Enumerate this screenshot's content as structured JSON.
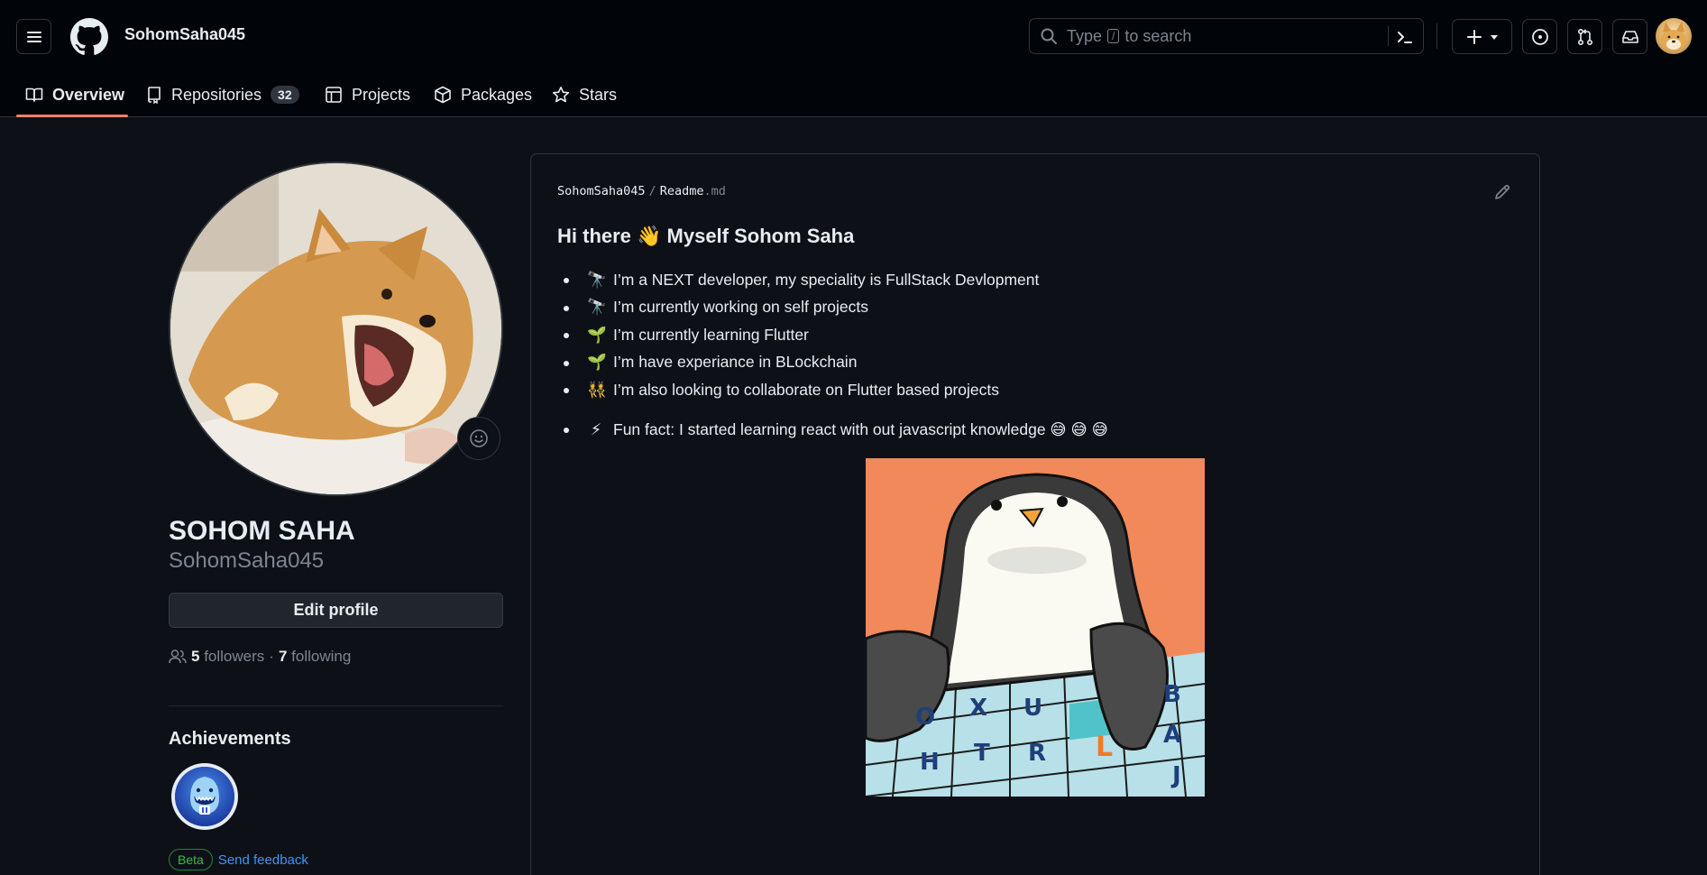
{
  "header": {
    "username": "SohomSaha045",
    "search": {
      "prefix": "Type",
      "key": "/",
      "suffix": "to search"
    }
  },
  "tabs": [
    {
      "label": "Overview"
    },
    {
      "label": "Repositories",
      "count": "32"
    },
    {
      "label": "Projects"
    },
    {
      "label": "Packages"
    },
    {
      "label": "Stars"
    }
  ],
  "profile": {
    "full_name": "SOHOM SAHA",
    "login": "SohomSaha045",
    "edit_label": "Edit profile",
    "followers_count": "5",
    "followers_label": "followers",
    "dot": "·",
    "following_count": "7",
    "following_label": "following",
    "achievements_title": "Achievements",
    "beta_label": "Beta",
    "feedback_label": "Send feedback"
  },
  "readme": {
    "owner": "SohomSaha045",
    "sep": "/",
    "file": "Readme",
    "ext": ".md",
    "heading": "Hi there  👋  Myself Sohom Saha",
    "items": [
      {
        "emoji": "🔭",
        "text": "I’m a NEXT developer, my speciality is FullStack Devlopment"
      },
      {
        "emoji": "🔭",
        "text": "I’m currently working on self projects"
      },
      {
        "emoji": "🌱",
        "text": "I’m currently learning Flutter"
      },
      {
        "emoji": "🌱",
        "text": "I’m have experiance in BLockchain"
      },
      {
        "emoji": "👯",
        "text": "I’m also looking to collaborate on Flutter based projects"
      }
    ],
    "fun_fact": {
      "emoji": "⚡",
      "text": "Fun fact: I started learning react with out javascript knowledge 😅 😅 😅"
    }
  },
  "colors": {
    "bg": "#0d1117",
    "header_bg": "#010409",
    "border": "#30363d",
    "accent_underline": "#f78166",
    "link": "#4493f8",
    "beta_green": "#3fb950"
  }
}
